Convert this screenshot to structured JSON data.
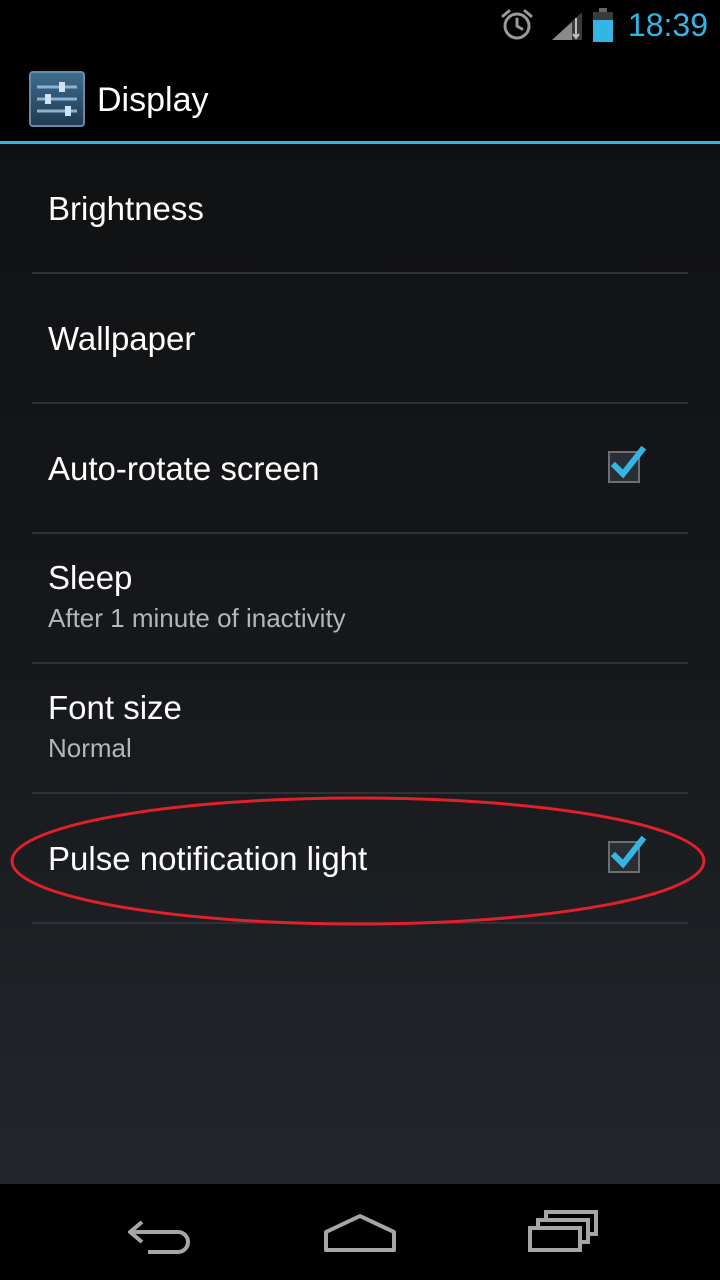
{
  "status_bar": {
    "time": "18:39",
    "icons": [
      "alarm-icon",
      "signal-icon",
      "battery-icon"
    ],
    "accent_color": "#33b5e5"
  },
  "action_bar": {
    "title": "Display",
    "icon": "settings-sliders-icon"
  },
  "preferences": [
    {
      "title": "Brightness"
    },
    {
      "title": "Wallpaper"
    },
    {
      "title": "Auto-rotate screen",
      "checked": true
    },
    {
      "title": "Sleep",
      "summary": "After 1 minute of inactivity"
    },
    {
      "title": "Font size",
      "summary": "Normal"
    },
    {
      "title": "Pulse notification light",
      "checked": true
    }
  ],
  "annotation": {
    "shape": "red-ellipse",
    "color": "#e0202a",
    "target": "Pulse notification light"
  },
  "nav_bar": {
    "buttons": [
      "back-icon",
      "home-icon",
      "recent-apps-icon"
    ]
  }
}
